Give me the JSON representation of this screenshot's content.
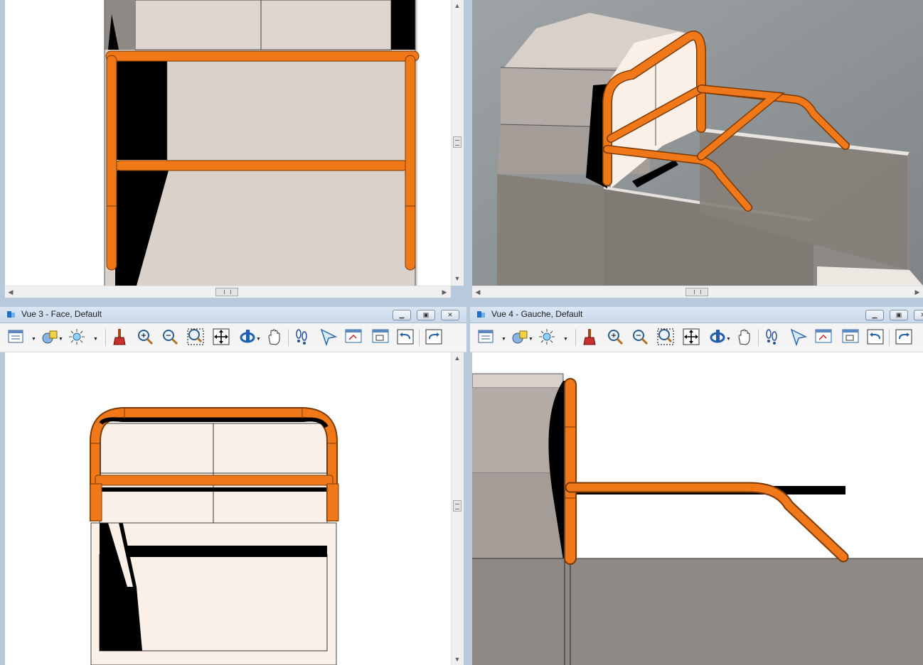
{
  "colors": {
    "accent_orange": "#f07818",
    "window_frame": "#b9c9dc",
    "title_gradient": "#dce7f4",
    "wall_gray": "#8f8985",
    "panel_beige": "#d9d1ca",
    "panel_light": "#faf0e8"
  },
  "views": [
    {
      "id": "view1",
      "title": "",
      "kind": "top-left-elevation"
    },
    {
      "id": "view2",
      "title": "",
      "kind": "isometric"
    },
    {
      "id": "view3",
      "title": "Vue 3 - Face, Default",
      "kind": "front"
    },
    {
      "id": "view4",
      "title": "Vue 4 - Gauche, Default",
      "kind": "left"
    }
  ],
  "window_buttons": {
    "minimize": "minimize-icon",
    "restore": "restore-icon",
    "close": "close-icon"
  },
  "toolbar_icons": [
    "view-attributes-icon",
    "display-style-icon",
    "lighting-icon",
    "clear-view-icon",
    "zoom-in-icon",
    "zoom-out-icon",
    "window-area-icon",
    "fit-view-icon",
    "rotate-view-icon",
    "pan-view-icon",
    "walk-icon",
    "view-previous-icon",
    "view-next-icon",
    "copy-view-icon",
    "undo-view-icon",
    "redo-view-icon",
    "view-more-icon"
  ],
  "scroll_glyphs": {
    "thumb": "III",
    "up": "▲",
    "down": "▼",
    "left": "◀",
    "right": "▶"
  }
}
